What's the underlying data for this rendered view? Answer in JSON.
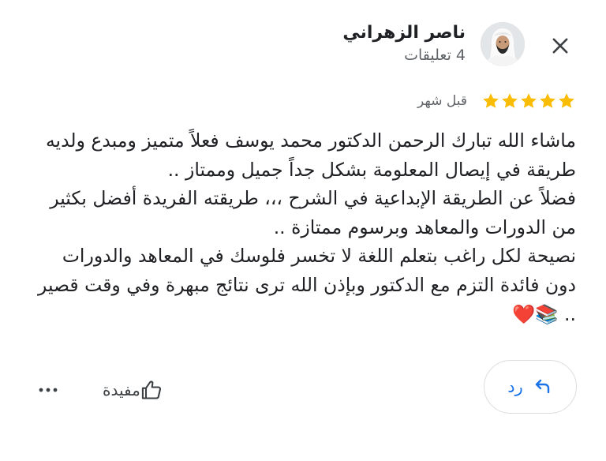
{
  "header": {
    "author_name": "ناصر الزهراني",
    "author_meta": "4 تعليقات"
  },
  "rating": {
    "stars": 5,
    "max_stars": 5,
    "time_ago": "قبل شهر",
    "star_color": "#fbbc04"
  },
  "review": {
    "text": "ماشاء الله تبارك الرحمن الدكتور محمد يوسف فعلاً متميز ومبدع ولديه طريقة في إيصال المعلومة بشكل جداً جميل وممتاز ..\nفضلاً عن الطريقة الإبداعية في الشرح ،،، طريقته الفريدة أفضل بكثير من الدورات والمعاهد وبرسوم ممتازة ..\nنصيحة لكل راغب بتعلم اللغة لا تخسر فلوسك في المعاهد والدورات دون فائدة التزم مع الدكتور وبإذن الله ترى نتائج مبهرة وفي وقت قصير .. ",
    "emoji_tail": "📚❤️"
  },
  "actions": {
    "helpful_label": "مفيدة",
    "reply_label": "رد",
    "accent_color": "#1a73e8"
  }
}
